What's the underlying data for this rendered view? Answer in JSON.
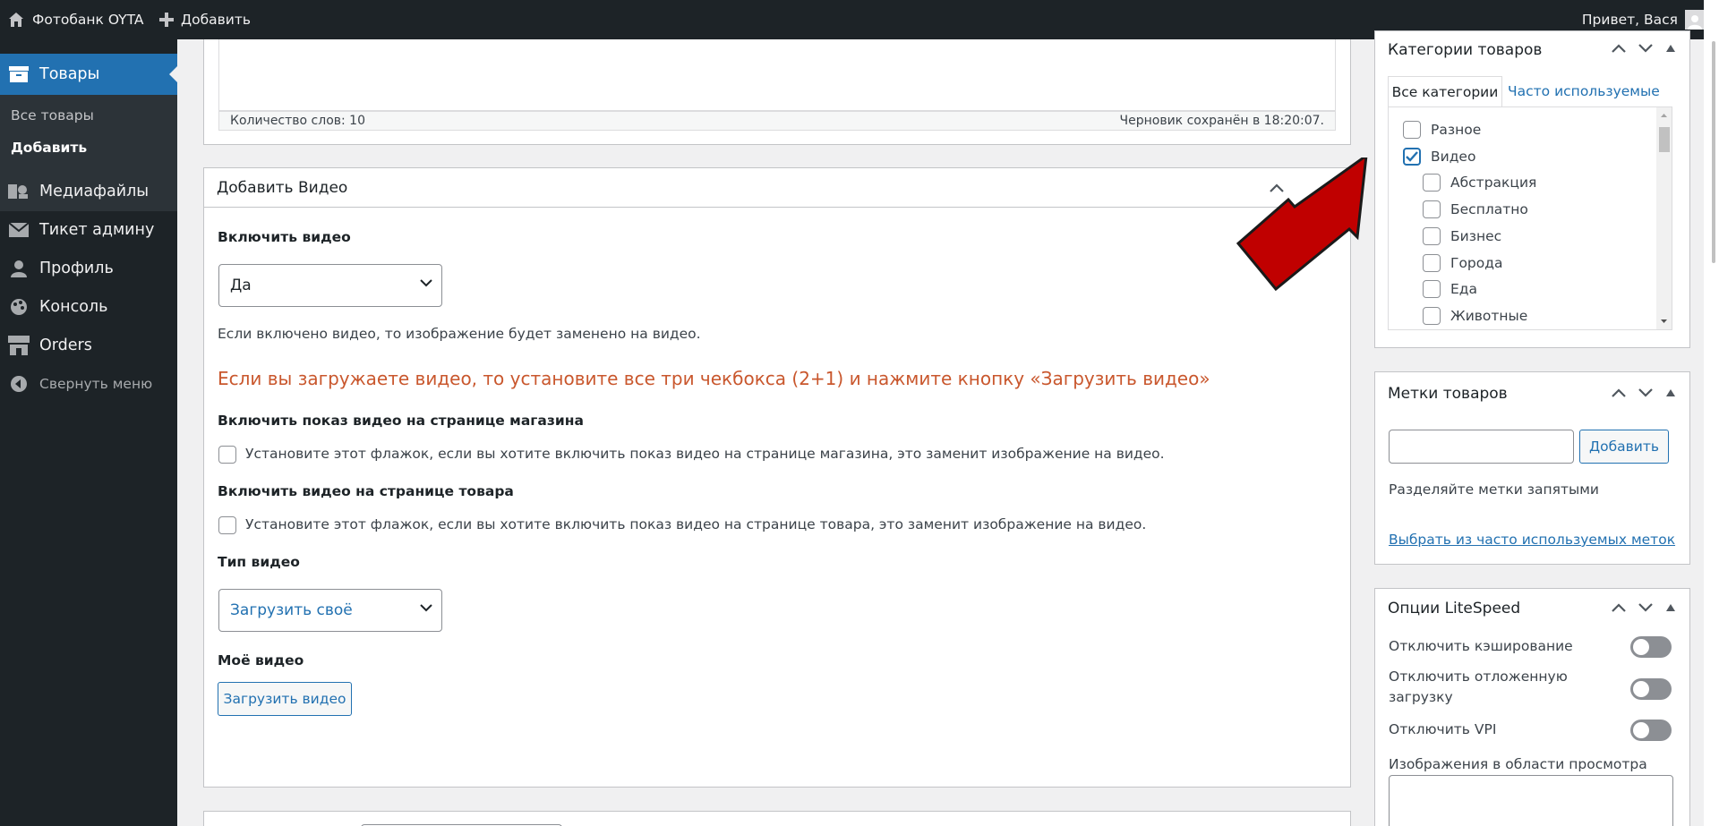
{
  "adminbar": {
    "site_name": "Фотобанк OYTA",
    "add_new": "Добавить",
    "greeting": "Привет, Вася",
    "icons": [
      "home-icon",
      "plus-icon",
      "avatar"
    ]
  },
  "sidebar": {
    "active_item": "Товары",
    "submenu": [
      "Все товары",
      "Добавить"
    ],
    "items": [
      {
        "label": "Медиафайлы",
        "icon": "media-icon"
      },
      {
        "label": "Тикет админу",
        "icon": "mail-icon"
      },
      {
        "label": "Профиль",
        "icon": "user-icon"
      },
      {
        "label": "Консоль",
        "icon": "palette-icon"
      },
      {
        "label": "Orders",
        "icon": "store-icon"
      }
    ],
    "collapse_label": "Свернуть меню"
  },
  "editor": {
    "word_count": "Количество слов: 10",
    "draft_saved": "Черновик сохранён в 18:20:07."
  },
  "video_box": {
    "title": "Добавить Видео",
    "enable_video_label": "Включить видео",
    "enable_video_value": "Да",
    "enable_video_desc": "Если включено видео, то изображение будет заменено на видео.",
    "notice": "Если вы загружаете видео, то установите все три чекбокса (2+1) и нажмите кнопку «Загрузить видео»",
    "shop_page_label": "Включить показ видео на странице магазина",
    "shop_page_desc": "Установите этот флажок, если вы хотите включить показ видео на странице магазина, это заменит изображение на видео.",
    "product_page_label": "Включить видео на странице товара",
    "product_page_desc": "Установите этот флажок, если вы хотите включить показ видео на странице товара, это заменит изображение на видео.",
    "video_type_label": "Тип видео",
    "video_type_value": "Загрузить своё",
    "my_video_label": "Моё видео",
    "upload_button": "Загрузить видео"
  },
  "categories_box": {
    "title": "Категории товаров",
    "tab_all": "Все категории",
    "tab_popular": "Часто используемые",
    "items": [
      {
        "label": "Разное",
        "checked": false,
        "level": 0
      },
      {
        "label": "Видео",
        "checked": true,
        "level": 0
      },
      {
        "label": "Абстракция",
        "checked": false,
        "level": 1
      },
      {
        "label": "Бесплатно",
        "checked": false,
        "level": 1
      },
      {
        "label": "Бизнес",
        "checked": false,
        "level": 1
      },
      {
        "label": "Города",
        "checked": false,
        "level": 1
      },
      {
        "label": "Еда",
        "checked": false,
        "level": 1
      },
      {
        "label": "Животные",
        "checked": false,
        "level": 1
      }
    ]
  },
  "tags_box": {
    "title": "Метки товаров",
    "add_button": "Добавить",
    "hint": "Разделяйте метки запятыми",
    "popular_link": "Выбрать из часто используемых меток"
  },
  "litespeed_box": {
    "title": "Опции LiteSpeed",
    "options": [
      "Отключить кэширование",
      "Отключить отложенную загрузку",
      "Отключить VPI"
    ],
    "viewport_images_label": "Изображения в области просмотра"
  },
  "colors": {
    "accent": "#2271b1",
    "admin_dark": "#1d2327",
    "notice": "#c9572d",
    "arrow_red": "#c00000"
  }
}
